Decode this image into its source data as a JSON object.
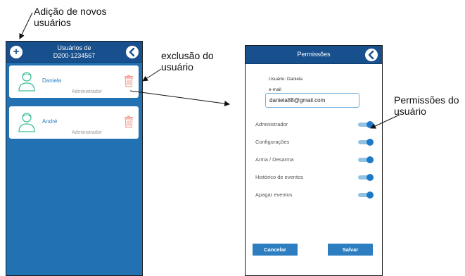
{
  "annotations": {
    "add": "Adição de novos\nusuários",
    "delete": "exclusão do\nusuário",
    "permissions": "Permissões do\nusuário"
  },
  "users_screen": {
    "title": "Usuários de",
    "subtitle": "D200-1234567",
    "add_icon": "plus-icon",
    "back_icon": "chevron-left-icon",
    "users": [
      {
        "name": "Daniela",
        "role": "Administrador"
      },
      {
        "name": "André",
        "role": "Administrador"
      }
    ]
  },
  "permissions_screen": {
    "title": "Permissões",
    "user_label": "Usuário: Daniela",
    "email_label": "e-mail",
    "email_value": "daniela88@gmail.com",
    "permissions": [
      {
        "label": "Administrador",
        "enabled": true
      },
      {
        "label": "Configurações",
        "enabled": true
      },
      {
        "label": "Arma / Desarma",
        "enabled": true
      },
      {
        "label": "Histórico de eventos",
        "enabled": true
      },
      {
        "label": "Apagar eventos",
        "enabled": true
      }
    ],
    "cancel_label": "Cancelar",
    "save_label": "Salvar"
  },
  "colors": {
    "header": "#18508d",
    "background": "#2271b2",
    "accent": "#1e79c6",
    "trash": "#f3a6a0"
  }
}
